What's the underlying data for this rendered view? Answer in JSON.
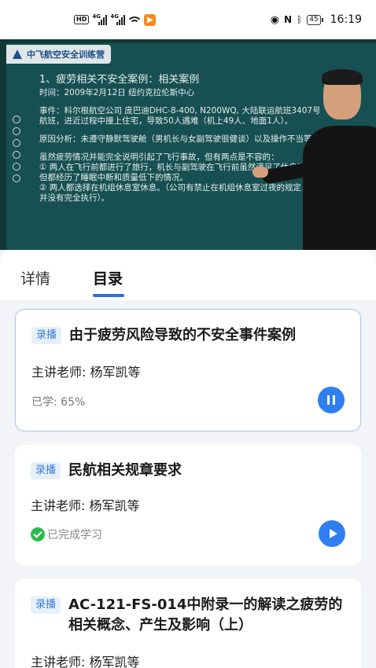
{
  "status_bar": {
    "network_badge": "HD",
    "signal_1": "4G",
    "signal_2": "4G",
    "battery": "45",
    "time": "16:19"
  },
  "video": {
    "logo_text": "中飞航空安全训练营",
    "slide_title": "1、疲劳相关不安全案例：相关案例",
    "slide_time": "时间：2009年2月12日  纽约克拉伦斯中心",
    "slide_event": "事件：科尔根航空公司 庞巴迪DHC-8-400, N200WQ, 大陆联运航班3407号航班，进近过程中撞上住宅，导致50人遇难（机上49人、地面1人）。",
    "slide_cause": "原因分析：未遵守静默驾驶舱（男机长与女副驾驶很健谈）以及操作不当等。",
    "slide_note_1": "虽然疲劳情况并能完全说明引起了飞行事故，但有两点是不容的：",
    "slide_note_2": "① 两人在飞行前都进行了旅行，机长与副驾驶在飞行前虽然满足了休息时长，但都经历了睡眠中断和质量低下的情况。",
    "slide_note_3": "② 两人都选择在机组休息室休息。（公司有禁止在机组休息室过夜的规定，但并没有完全执行）。"
  },
  "tabs": {
    "details": "详情",
    "catalog": "目录"
  },
  "lessons": [
    {
      "tag": "录播",
      "title": "由于疲劳风险导致的不安全事件案例",
      "teacher": "主讲老师: 杨军凯等",
      "status": "已学: 65%",
      "progress_percent": 65,
      "button_icon": "pause-icon"
    },
    {
      "tag": "录播",
      "title": "民航相关规章要求",
      "teacher": "主讲老师: 杨军凯等",
      "status": "已完成学习",
      "button_icon": "play-icon"
    },
    {
      "tag": "录播",
      "title": "AC-121-FS-014中附录一的解读之疲劳的相关概念、产生及影响（上）",
      "teacher": "主讲老师: 杨军凯等"
    }
  ],
  "colors": {
    "accent": "#2f7ff0",
    "tag_bg": "#e6f0fb",
    "tag_text": "#3b7ad9",
    "done_check": "#2fb84f",
    "video_bg": "#175052"
  }
}
